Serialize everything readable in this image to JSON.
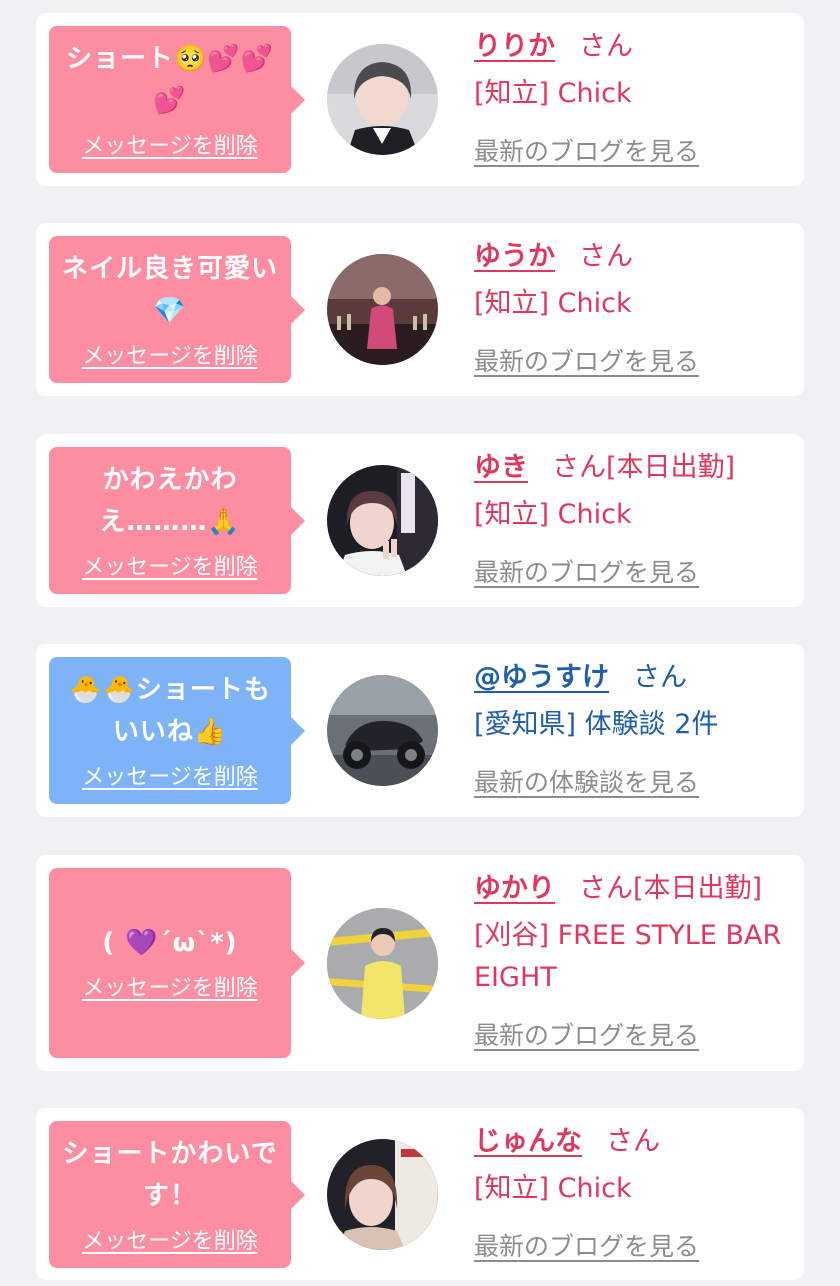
{
  "colors": {
    "card_bg": "#ffffff",
    "page_bg": "#f1f1f3",
    "bubble_pink": "#fd8ea1",
    "bubble_blue": "#7eb3f7",
    "name_pink": "#e0375f",
    "name_blue": "#1f5ea8",
    "link_gray": "#8d8d8d"
  },
  "messages": [
    {
      "bubble_text": "ショート🥺💕💕💕",
      "delete_label": "メッセージを削除",
      "name": "りりか",
      "suffix": "さん",
      "shop": "[知立] Chick",
      "latest_link": "最新のブログを見る",
      "bubble_color": "pink",
      "avatar_icon": "woman-portrait-avatar"
    },
    {
      "bubble_text": "ネイル良き可愛い💎",
      "delete_label": "メッセージを削除",
      "name": "ゆうか",
      "suffix": "さん",
      "shop": "[知立] Chick",
      "latest_link": "最新のブログを見る",
      "bubble_color": "pink",
      "avatar_icon": "woman-in-bar-avatar"
    },
    {
      "bubble_text": "かわえかわえ………🙏",
      "delete_label": "メッセージを削除",
      "name": "ゆき",
      "suffix": "さん[本日出勤]",
      "shop": "[知立] Chick",
      "latest_link": "最新のブログを見る",
      "bubble_color": "pink",
      "avatar_icon": "woman-peace-sign-avatar"
    },
    {
      "bubble_text": "🐣🐣ショートもいいね👍",
      "delete_label": "メッセージを削除",
      "name": "@ゆうすけ",
      "suffix": "さん",
      "shop": "[愛知県] 体験談 2件",
      "latest_link": "最新の体験談を見る",
      "bubble_color": "blue",
      "avatar_icon": "motorcycle-avatar"
    },
    {
      "bubble_text": "( 💜´ω`*)",
      "delete_label": "メッセージを削除",
      "name": "ゆかり",
      "suffix": "さん[本日出勤]",
      "shop": "[刈谷] FREE STYLE BAR EIGHT",
      "latest_link": "最新のブログを見る",
      "bubble_color": "pink",
      "avatar_icon": "person-yellow-hoodie-avatar"
    },
    {
      "bubble_text": "ショートかわいです！",
      "delete_label": "メッセージを削除",
      "name": "じゅんな",
      "suffix": "さん",
      "shop": "[知立] Chick",
      "latest_link": "最新のブログを見る",
      "bubble_color": "pink",
      "avatar_icon": "woman-poster-avatar"
    }
  ]
}
